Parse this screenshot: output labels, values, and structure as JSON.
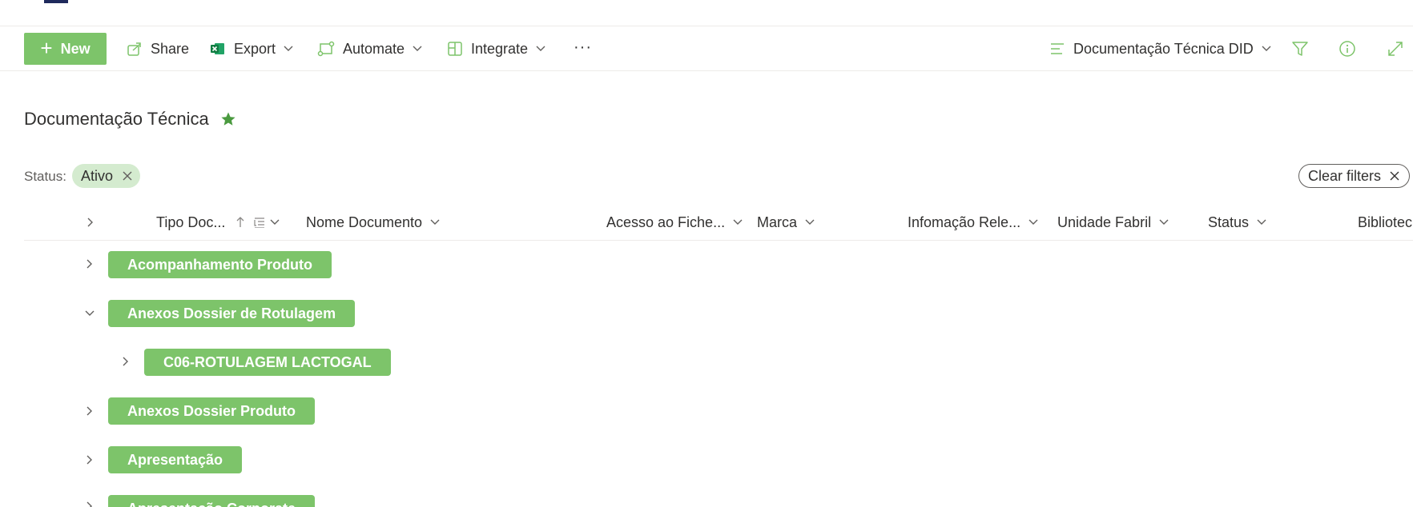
{
  "toolbar": {
    "new_label": "New",
    "share_label": "Share",
    "export_label": "Export",
    "automate_label": "Automate",
    "integrate_label": "Integrate",
    "more_label": "···",
    "view_label": "Documentação Técnica DID"
  },
  "page": {
    "title": "Documentação Técnica"
  },
  "filters": {
    "label": "Status:",
    "chip_label": "Ativo",
    "clear_label": "Clear filters"
  },
  "columns": [
    "Tipo Doc...",
    "Nome Documento",
    "Acesso ao Fiche...",
    "Marca",
    "Infomação Rele...",
    "Unidade Fabril",
    "Status",
    "Bibliotec"
  ],
  "groups": [
    {
      "label": "Acompanhamento Produto",
      "expanded": false,
      "level": 0
    },
    {
      "label": "Anexos Dossier de Rotulagem",
      "expanded": true,
      "level": 0
    },
    {
      "label": "C06-ROTULAGEM LACTOGAL",
      "expanded": false,
      "level": 1
    },
    {
      "label": "Anexos Dossier Produto",
      "expanded": false,
      "level": 0
    },
    {
      "label": "Apresentação",
      "expanded": false,
      "level": 0
    },
    {
      "label": "Apresentação Corporate",
      "expanded": false,
      "level": 0
    }
  ],
  "colors": {
    "accent": "#7dc46a",
    "chip_bg": "#d4ebcf",
    "star": "#4a9a3f"
  }
}
